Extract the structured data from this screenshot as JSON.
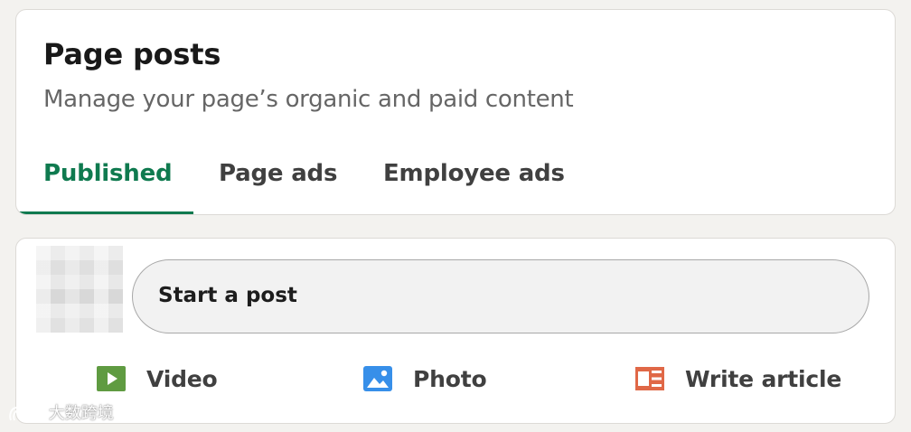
{
  "header": {
    "title": "Page posts",
    "subtitle": "Manage your page’s organic and paid content"
  },
  "tabs": [
    {
      "label": "Published",
      "active": true
    },
    {
      "label": "Page ads",
      "active": false
    },
    {
      "label": "Employee ads",
      "active": false
    }
  ],
  "share_box": {
    "start_post_label": "Start a post",
    "actions": [
      {
        "label": "Video",
        "icon": "video-icon"
      },
      {
        "label": "Photo",
        "icon": "photo-icon"
      },
      {
        "label": "Write article",
        "icon": "article-icon"
      }
    ]
  },
  "watermark": {
    "text": "大数跨境"
  },
  "colors": {
    "accent": "#0f7a4f",
    "video_icon": "#5f9b41",
    "photo_icon": "#378fe9",
    "article_icon": "#e06847",
    "background": "#f3f2ef"
  }
}
